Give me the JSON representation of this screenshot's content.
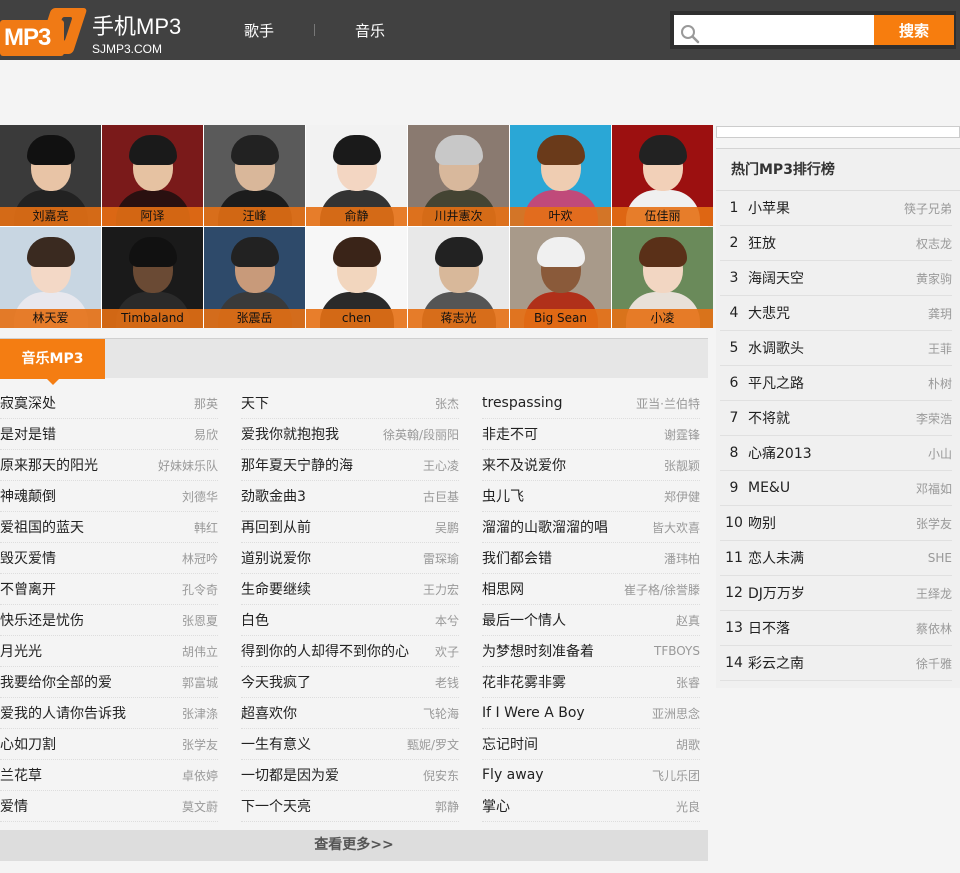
{
  "header": {
    "logo_badge": "MP3",
    "logo_title": "手机MP3",
    "logo_sub": "SJMP3.COM",
    "nav": [
      "歌手",
      "音乐"
    ],
    "search_placeholder": "",
    "search_button": "搜索"
  },
  "artists": [
    {
      "name": "刘嘉亮",
      "bg": "#3a3a3a",
      "face": "#e8c4a6",
      "hair": "#111",
      "body": "#222"
    },
    {
      "name": "阿译",
      "bg": "#7a1a1a",
      "face": "#e6c2a2",
      "hair": "#1a1a1a",
      "body": "#2a1010"
    },
    {
      "name": "汪峰",
      "bg": "#5a5a5a",
      "face": "#d9b79a",
      "hair": "#222",
      "body": "#1c1c1c"
    },
    {
      "name": "俞静",
      "bg": "#f2f2f2",
      "face": "#f3d6c2",
      "hair": "#1a1a1a",
      "body": "#333"
    },
    {
      "name": "川井憲次",
      "bg": "#8a7a70",
      "face": "#d8b89c",
      "hair": "#c8c8c8",
      "body": "#443"
    },
    {
      "name": "叶欢",
      "bg": "#2aa7d6",
      "face": "#efcdb2",
      "hair": "#6a3a1a",
      "body": "#c04a7a"
    },
    {
      "name": "伍佳丽",
      "bg": "#9c1010",
      "face": "#f2d0b8",
      "hair": "#222",
      "body": "#f0f0f0"
    },
    {
      "name": "林天爱",
      "bg": "#c8d6e2",
      "face": "#f3d8c6",
      "hair": "#3a2a20",
      "body": "#e8e8ee"
    },
    {
      "name": "Timbaland",
      "bg": "#1a1a1a",
      "face": "#6a4a34",
      "hair": "#111",
      "body": "#2a2a2a"
    },
    {
      "name": "张震岳",
      "bg": "#2e4a6a",
      "face": "#c89a7a",
      "hair": "#222",
      "body": "#3a3a3a"
    },
    {
      "name": "chen",
      "bg": "#f7f7f7",
      "face": "#f2d6be",
      "hair": "#3a2418",
      "body": "#2a2a2a"
    },
    {
      "name": "蒋志光",
      "bg": "#e8e8e8",
      "face": "#d8b89a",
      "hair": "#222",
      "body": "#555"
    },
    {
      "name": "Big Sean",
      "bg": "#a89a8a",
      "face": "#8a5a3a",
      "hair": "#f0f0f0",
      "body": "#b0301a"
    },
    {
      "name": "小凌",
      "bg": "#6a8a5a",
      "face": "#f2d6c2",
      "hair": "#5a3018",
      "body": "#e8e0d8"
    }
  ],
  "music_tab": "音乐MP3",
  "songs": [
    [
      {
        "title": "寂寞深处",
        "artist": "那英"
      },
      {
        "title": "是对是错",
        "artist": "易欣"
      },
      {
        "title": "原来那天的阳光",
        "artist": "好妹妹乐队"
      },
      {
        "title": "神魂颠倒",
        "artist": "刘德华"
      },
      {
        "title": "爱祖国的蓝天",
        "artist": "韩红"
      },
      {
        "title": "毁灭爱情",
        "artist": "林冠吟"
      },
      {
        "title": "不曾离开",
        "artist": "孔令奇"
      },
      {
        "title": "快乐还是忧伤",
        "artist": "张恩夏"
      },
      {
        "title": "月光光",
        "artist": "胡伟立"
      },
      {
        "title": "我要给你全部的爱",
        "artist": "郭富城"
      },
      {
        "title": "爱我的人请你告诉我",
        "artist": "张津涤"
      },
      {
        "title": "心如刀割",
        "artist": "张学友"
      },
      {
        "title": "兰花草",
        "artist": "卓依婷"
      },
      {
        "title": "爱情",
        "artist": "莫文蔚"
      }
    ],
    [
      {
        "title": "天下",
        "artist": "张杰"
      },
      {
        "title": "爱我你就抱抱我",
        "artist": "徐英翰/段丽阳"
      },
      {
        "title": "那年夏天宁静的海",
        "artist": "王心凌"
      },
      {
        "title": "劲歌金曲3",
        "artist": "古巨基"
      },
      {
        "title": "再回到从前",
        "artist": "吴鹏"
      },
      {
        "title": "道别说爱你",
        "artist": "雷琛瑜"
      },
      {
        "title": "生命要继续",
        "artist": "王力宏"
      },
      {
        "title": "白色",
        "artist": "本兮"
      },
      {
        "title": "得到你的人却得不到你的心",
        "artist": "欢子"
      },
      {
        "title": "今天我疯了",
        "artist": "老钱"
      },
      {
        "title": "超喜欢你",
        "artist": "飞轮海"
      },
      {
        "title": "一生有意义",
        "artist": "甄妮/罗文"
      },
      {
        "title": "一切都是因为爱",
        "artist": "倪安东"
      },
      {
        "title": "下一个天亮",
        "artist": "郭静"
      }
    ],
    [
      {
        "title": "trespassing",
        "artist": "亚当·兰伯特"
      },
      {
        "title": "非走不可",
        "artist": "谢霆锋"
      },
      {
        "title": "来不及说爱你",
        "artist": "张靓颖"
      },
      {
        "title": "虫儿飞",
        "artist": "郑伊健"
      },
      {
        "title": "溜溜的山歌溜溜的唱",
        "artist": "皆大欢喜"
      },
      {
        "title": "我们都会错",
        "artist": "潘玮柏"
      },
      {
        "title": "相思网",
        "artist": "崔子格/徐誉滕"
      },
      {
        "title": "最后一个情人",
        "artist": "赵真"
      },
      {
        "title": "为梦想时刻准备着",
        "artist": "TFBOYS"
      },
      {
        "title": "花非花雾非雾",
        "artist": "张睿"
      },
      {
        "title": "If I Were A Boy",
        "artist": "亚洲思念"
      },
      {
        "title": "忘记时间",
        "artist": "胡歌"
      },
      {
        "title": "Fly away",
        "artist": "飞儿乐团"
      },
      {
        "title": "掌心",
        "artist": "光良"
      }
    ]
  ],
  "more_label": "查看更多>>",
  "ranking": {
    "title": "热门MP3排行榜",
    "items": [
      {
        "num": "1",
        "song": "小苹果",
        "artist": "筷子兄弟"
      },
      {
        "num": "2",
        "song": "狂放",
        "artist": "权志龙"
      },
      {
        "num": "3",
        "song": "海阔天空",
        "artist": "黄家驹"
      },
      {
        "num": "4",
        "song": "大悲咒",
        "artist": "龚玥"
      },
      {
        "num": "5",
        "song": "水调歌头",
        "artist": "王菲"
      },
      {
        "num": "6",
        "song": "平凡之路",
        "artist": "朴树"
      },
      {
        "num": "7",
        "song": "不将就",
        "artist": "李荣浩"
      },
      {
        "num": "8",
        "song": "心痛2013",
        "artist": "小山"
      },
      {
        "num": "9",
        "song": "ME&U",
        "artist": "邓福如"
      },
      {
        "num": "10",
        "song": "吻别",
        "artist": "张学友"
      },
      {
        "num": "11",
        "song": "恋人未满",
        "artist": "SHE"
      },
      {
        "num": "12",
        "song": "DJ万万岁",
        "artist": "王绎龙"
      },
      {
        "num": "13",
        "song": "日不落",
        "artist": "蔡依林"
      },
      {
        "num": "14",
        "song": "彩云之南",
        "artist": "徐千雅"
      }
    ]
  }
}
